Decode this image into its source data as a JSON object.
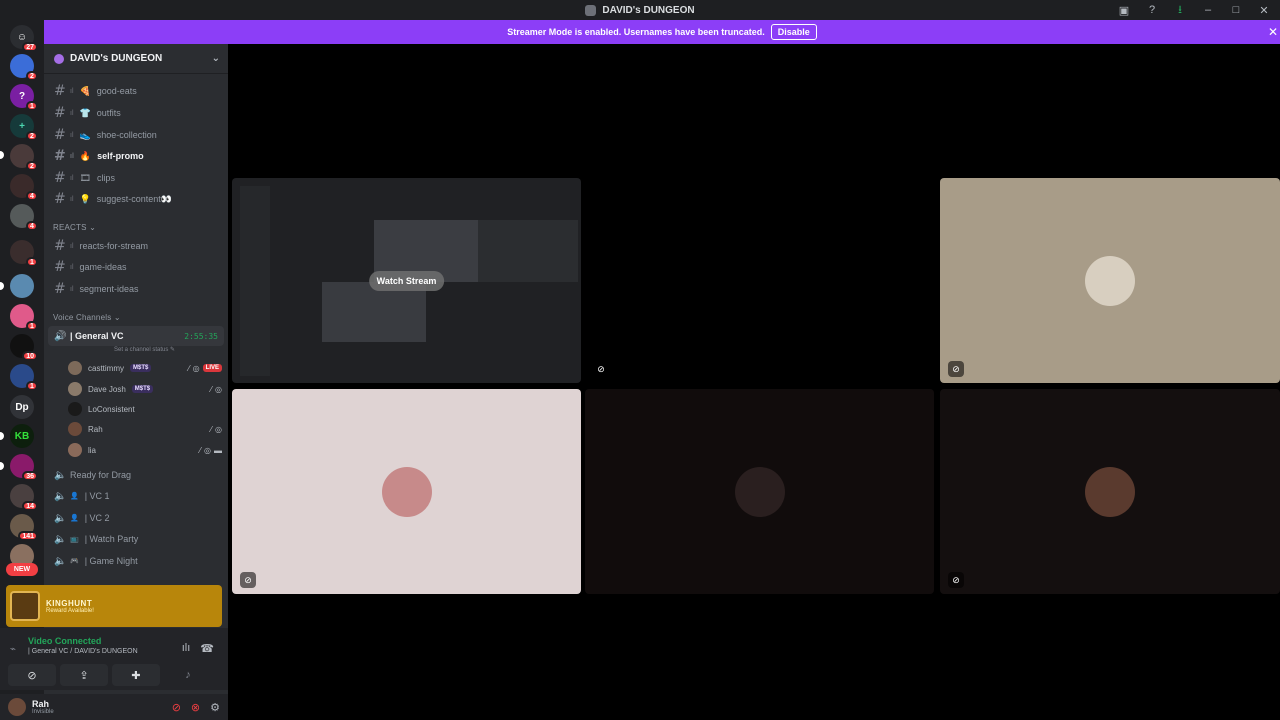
{
  "window": {
    "title": "DAVID's DUNGEON"
  },
  "banner": {
    "message": "Streamer Mode is enabled. Usernames have been truncated.",
    "disable_label": "Disable"
  },
  "rail": {
    "badges": [
      "27",
      "2",
      "1",
      "2",
      "2",
      "4",
      "4",
      "1",
      "1",
      "10",
      "1",
      "36",
      "14",
      "141"
    ],
    "text_server": "Dp",
    "new_label": "NEW"
  },
  "guild": {
    "name": "DAVID's DUNGEON"
  },
  "channels": [
    {
      "label": "good-eats",
      "emoji": "🍕"
    },
    {
      "label": "outfits",
      "emoji": "👕"
    },
    {
      "label": "shoe-collection",
      "emoji": "👟"
    },
    {
      "label": "self-promo",
      "emoji": "🔥"
    },
    {
      "label": "clips",
      "emoji": "🎞"
    },
    {
      "label": "suggest-content👀",
      "emoji": "💡"
    }
  ],
  "reacts": {
    "category": "REACTS",
    "channels": [
      {
        "label": "reacts-for-stream"
      },
      {
        "label": "game-ideas"
      },
      {
        "label": "segment-ideas"
      }
    ]
  },
  "voice": {
    "category": "Voice Channels",
    "general": {
      "label": "| General VC",
      "timer": "2:55:35",
      "status": "Set a channel status"
    },
    "members": [
      {
        "name": "casttimmy",
        "tag": "M$T$",
        "live": "LIVE"
      },
      {
        "name": "Dave Josh",
        "tag": "M$T$"
      },
      {
        "name": "LoConsistent"
      },
      {
        "name": "Rah"
      },
      {
        "name": "lia"
      }
    ],
    "other": [
      {
        "label": "Ready for Drag"
      },
      {
        "label": "| VC 1"
      },
      {
        "label": "| VC 2"
      },
      {
        "label": "| Watch Party"
      },
      {
        "label": "| Game Night"
      }
    ]
  },
  "reward": {
    "title": "KINGHUNT",
    "subtitle": "Reward Available!"
  },
  "connection": {
    "status": "Video Connected",
    "location": "| General VC / DAVID's DUNGEON"
  },
  "user": {
    "name": "Rah",
    "status": "Invisible"
  },
  "stage": {
    "watch_label": "Watch Stream",
    "tile_colors": {
      "beige": "#a89c88",
      "light": "#dfd3d3",
      "dark1": "#110c0c",
      "dark2": "#140f0f"
    }
  },
  "colors": {
    "accent": "#8c3ef7",
    "connected": "#23a55a",
    "alert": "#f23f43",
    "reward": "#b8860b"
  }
}
